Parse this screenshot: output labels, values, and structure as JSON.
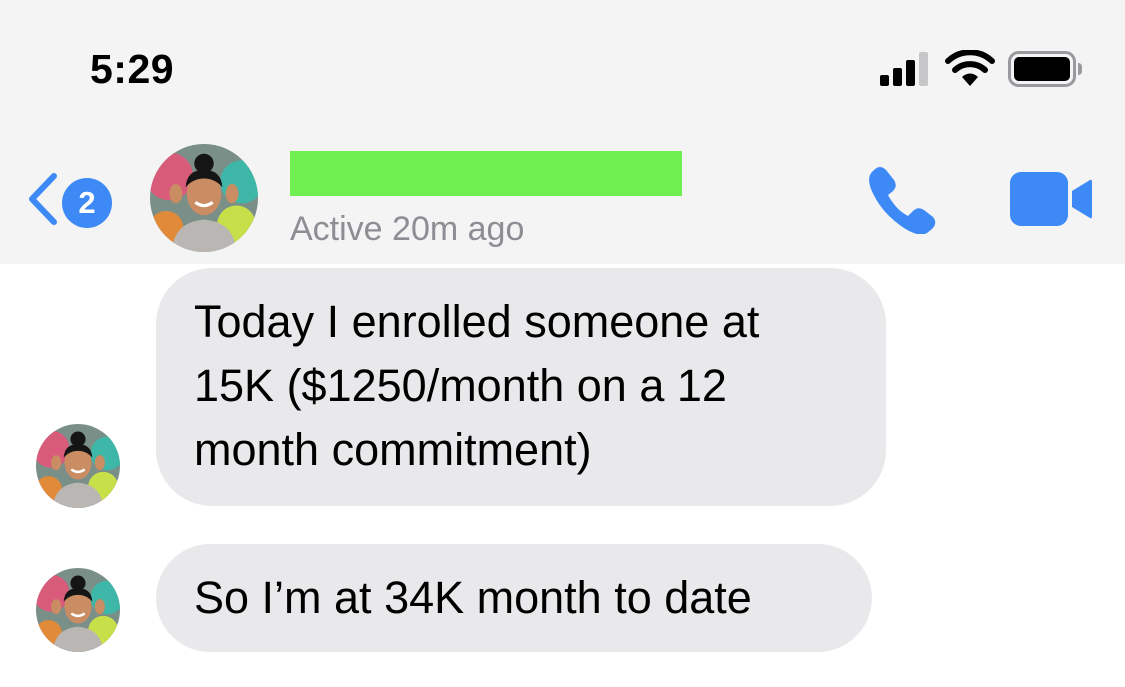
{
  "status_bar": {
    "time": "5:29",
    "icons": [
      "signal-bars-icon",
      "wifi-icon",
      "battery-icon"
    ]
  },
  "header": {
    "back_badge_count": "2",
    "back_icon": "chevron-left-icon",
    "contact_name_redacted": true,
    "active_status": "Active 20m ago",
    "actions": [
      "phone-icon",
      "video-camera-icon"
    ]
  },
  "messages": [
    {
      "text": "Today I enrolled someone at 15K ($1250/month on a 12 month commitment)"
    },
    {
      "text": "So I’m at 34K month to date"
    }
  ],
  "colors": {
    "accent": "#3d8af7",
    "bubble": "#e9e9eb",
    "redaction": "#6ff050",
    "secondary_text": "#8d8d93"
  }
}
